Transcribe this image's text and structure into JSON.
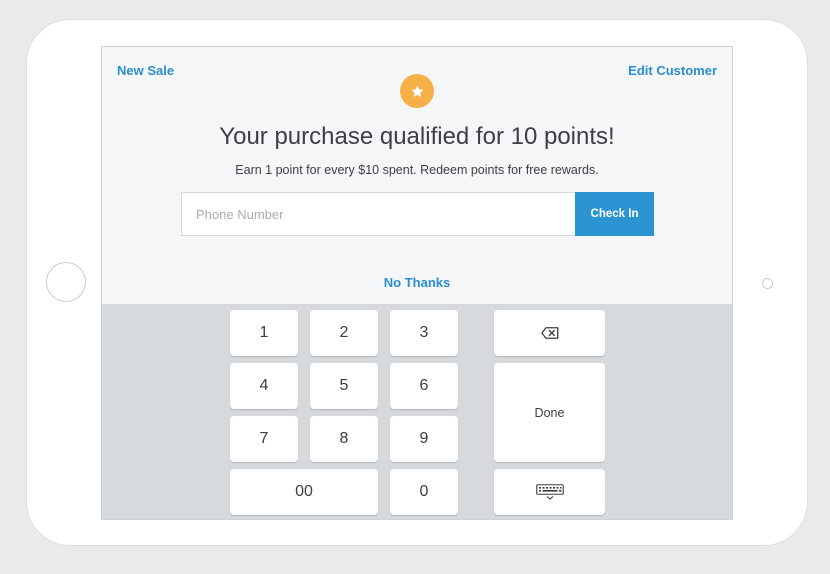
{
  "header": {
    "new_sale": "New Sale",
    "edit_customer": "Edit Customer"
  },
  "badge": {
    "icon": "star-icon",
    "color": "#f6b048"
  },
  "headline": "Your purchase qualified for 10 points!",
  "subline": "Earn 1 point for every $10 spent. Redeem points for free rewards.",
  "phone": {
    "placeholder": "Phone Number",
    "value": ""
  },
  "check_in_label": "Check In",
  "no_thanks_label": "No Thanks",
  "keypad": {
    "digits": [
      "1",
      "2",
      "3",
      "4",
      "5",
      "6",
      "7",
      "8",
      "9"
    ],
    "double_zero": "00",
    "zero": "0",
    "backspace_icon": "backspace-icon",
    "done_label": "Done",
    "keyboard_icon": "keyboard-icon"
  },
  "colors": {
    "accent": "#2b8fcd",
    "button": "#2b93d1",
    "keypad_bg": "#d7dadd"
  }
}
